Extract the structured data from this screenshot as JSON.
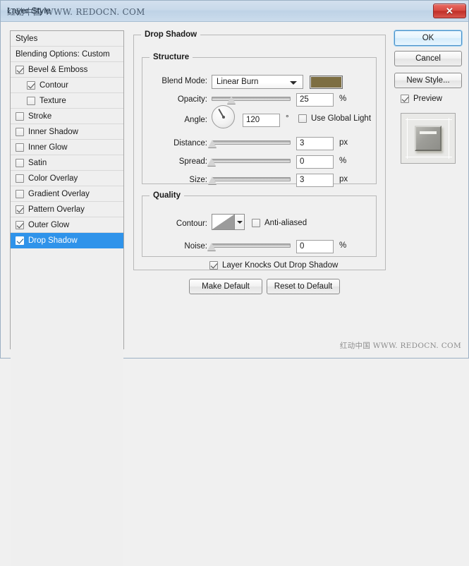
{
  "window": {
    "title": "Layer Style",
    "watermark": "红动中国 WWW. REDOCN. COM",
    "close_icon": "✕"
  },
  "styles_panel": {
    "rows": [
      {
        "label": "Styles",
        "type": "header",
        "indent": 0,
        "checked": null,
        "selected": false
      },
      {
        "label": "Blending Options: Custom",
        "type": "header",
        "indent": 0,
        "checked": null,
        "selected": false
      },
      {
        "label": "Bevel & Emboss",
        "type": "effect",
        "indent": 0,
        "checked": true,
        "selected": false
      },
      {
        "label": "Contour",
        "type": "effect",
        "indent": 1,
        "checked": true,
        "selected": false
      },
      {
        "label": "Texture",
        "type": "effect",
        "indent": 1,
        "checked": false,
        "selected": false
      },
      {
        "label": "Stroke",
        "type": "effect",
        "indent": 0,
        "checked": false,
        "selected": false
      },
      {
        "label": "Inner Shadow",
        "type": "effect",
        "indent": 0,
        "checked": false,
        "selected": false
      },
      {
        "label": "Inner Glow",
        "type": "effect",
        "indent": 0,
        "checked": false,
        "selected": false
      },
      {
        "label": "Satin",
        "type": "effect",
        "indent": 0,
        "checked": false,
        "selected": false
      },
      {
        "label": "Color Overlay",
        "type": "effect",
        "indent": 0,
        "checked": false,
        "selected": false
      },
      {
        "label": "Gradient Overlay",
        "type": "effect",
        "indent": 0,
        "checked": false,
        "selected": false
      },
      {
        "label": "Pattern Overlay",
        "type": "effect",
        "indent": 0,
        "checked": true,
        "selected": false
      },
      {
        "label": "Outer Glow",
        "type": "effect",
        "indent": 0,
        "checked": true,
        "selected": false
      },
      {
        "label": "Drop Shadow",
        "type": "effect",
        "indent": 0,
        "checked": true,
        "selected": true
      }
    ]
  },
  "main": {
    "group_title": "Drop Shadow",
    "structure": {
      "title": "Structure",
      "blend_mode_label": "Blend Mode:",
      "blend_mode_value": "Linear Burn",
      "shadow_color": "#7d6e42",
      "opacity_label": "Opacity:",
      "opacity_value": "25",
      "opacity_unit": "%",
      "opacity_pct": 25,
      "angle_label": "Angle:",
      "angle_value": "120",
      "angle_unit": "°",
      "use_global_light_label": "Use Global Light",
      "use_global_light_checked": false,
      "distance_label": "Distance:",
      "distance_value": "3",
      "distance_unit": "px",
      "distance_pct": 1,
      "spread_label": "Spread:",
      "spread_value": "0",
      "spread_unit": "%",
      "spread_pct": 0,
      "size_label": "Size:",
      "size_value": "3",
      "size_unit": "px",
      "size_pct": 1
    },
    "quality": {
      "title": "Quality",
      "contour_label": "Contour:",
      "anti_aliased_label": "Anti-aliased",
      "anti_aliased_checked": false,
      "noise_label": "Noise:",
      "noise_value": "0",
      "noise_unit": "%",
      "noise_pct": 0
    },
    "knockout_label": "Layer Knocks Out Drop Shadow",
    "knockout_checked": true,
    "make_default_label": "Make Default",
    "reset_default_label": "Reset to Default"
  },
  "right_panel": {
    "ok_label": "OK",
    "cancel_label": "Cancel",
    "new_style_label": "New Style...",
    "preview_label": "Preview",
    "preview_checked": true
  },
  "bottom_watermark": "红动中国 WWW. REDOCN. COM"
}
